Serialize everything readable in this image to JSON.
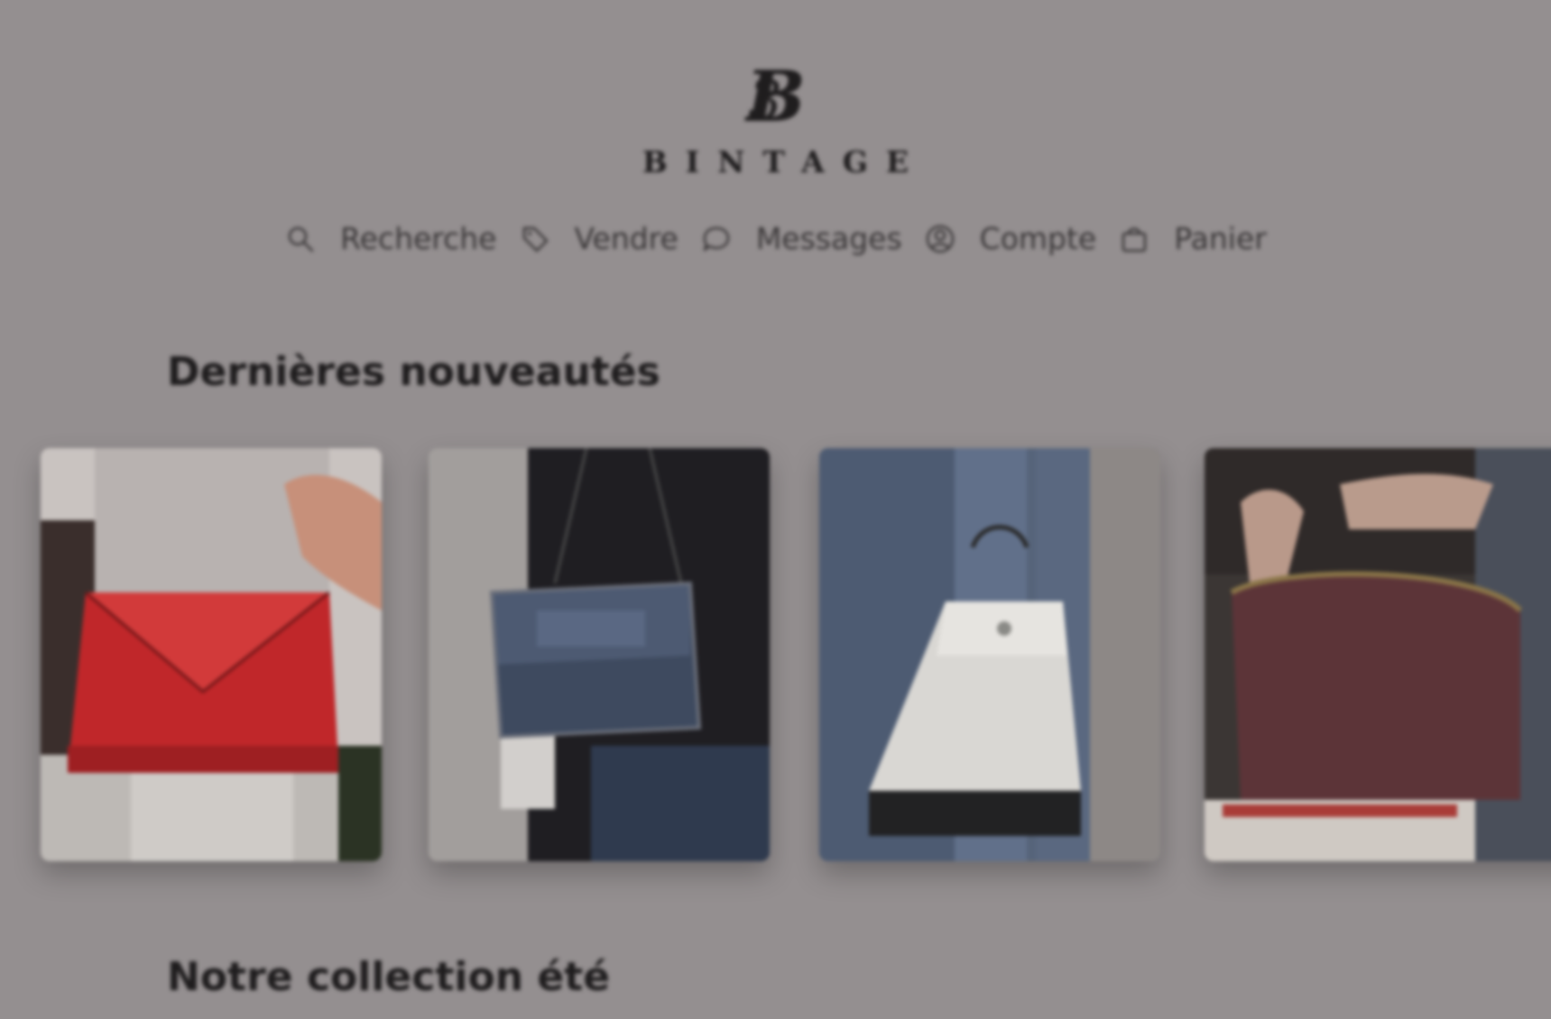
{
  "brand": {
    "monogram": "B",
    "name": "BINTAGE"
  },
  "nav": {
    "items": [
      {
        "label": "Recherche",
        "icon": "search-icon"
      },
      {
        "label": "Vendre",
        "icon": "tag-icon"
      },
      {
        "label": "Messages",
        "icon": "chat-bubble-icon"
      },
      {
        "label": "Compte",
        "icon": "user-icon"
      },
      {
        "label": "Panier",
        "icon": "shopping-bag-icon"
      }
    ]
  },
  "sections": {
    "latest_title": "Dernières nouveautés",
    "summer_title": "Notre collection été"
  },
  "products": [
    {
      "bag_color": "#a92a2c",
      "description_icon": "red-leather-clutch-photo"
    },
    {
      "bag_color": "#3f4a5c",
      "description_icon": "denim-chain-shoulder-bag-photo"
    },
    {
      "bag_color": "#d8d6d2",
      "description_icon": "white-bucket-bag-photo"
    },
    {
      "bag_color": "#5a3338",
      "description_icon": "burgundy-frame-bag-photo"
    }
  ]
}
